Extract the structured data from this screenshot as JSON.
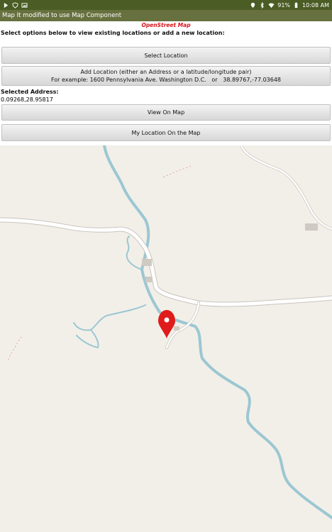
{
  "status_bar": {
    "battery": "91%",
    "time": "10:08 AM"
  },
  "app": {
    "title": "Map It modified to use Map Component",
    "subtitle": "OpenStreet Map",
    "instructions": "Select options below to view existing locations or add a new location:"
  },
  "buttons": {
    "select_location": "Select Location",
    "add_location_line1": "Add Location (either an Address or a latitude/longitude pair)",
    "add_location_line2": "For example: 1600 Pennsylvania Ave. Washington D.C.   or   38.89767,-77.03648",
    "view_on_map": "View On Map",
    "my_location": "My Location On the Map"
  },
  "selection": {
    "label": "Selected Address:",
    "value": "0.09268,28.95817"
  },
  "map": {
    "marker_icon": "map-pin-icon",
    "marker_color": "#e01b1b",
    "river_color": "#9bc7d2",
    "road_color": "#ffffff"
  }
}
